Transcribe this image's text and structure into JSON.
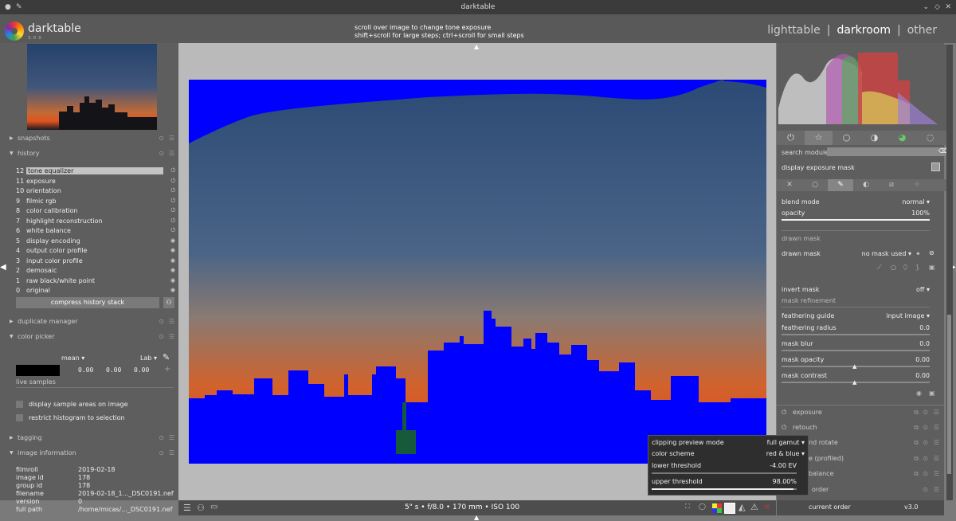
{
  "window": {
    "title": "darktable"
  },
  "header": {
    "app_name": "darktable",
    "app_version": "3.0.0",
    "hint_line1": "scroll over image to change tone exposure",
    "hint_line2": "shift+scroll for large steps; ctrl+scroll for small steps",
    "view_lighttable": "lighttable",
    "view_darkroom": "darkroom",
    "view_other": "other",
    "sep1": "|",
    "sep2": "|"
  },
  "left": {
    "snapshots": "snapshots",
    "history": "history",
    "history_items": [
      {
        "n": "12",
        "label": "tone equalizer"
      },
      {
        "n": "11",
        "label": "exposure"
      },
      {
        "n": "10",
        "label": "orientation"
      },
      {
        "n": "9",
        "label": "filmic rgb"
      },
      {
        "n": "8",
        "label": "color calibration"
      },
      {
        "n": "7",
        "label": "highlight reconstruction"
      },
      {
        "n": "6",
        "label": "white balance"
      },
      {
        "n": "5",
        "label": "display encoding"
      },
      {
        "n": "4",
        "label": "output color profile"
      },
      {
        "n": "3",
        "label": "input color profile"
      },
      {
        "n": "2",
        "label": "demosaic"
      },
      {
        "n": "1",
        "label": "raw black/white point"
      },
      {
        "n": "0",
        "label": "original"
      }
    ],
    "compress": "compress history stack",
    "duplicate_manager": "duplicate manager",
    "color_picker": "color picker",
    "picker_mode": "mean",
    "picker_space": "Lab",
    "picker_values": [
      "0.00",
      "0.00",
      "0.00"
    ],
    "live_samples": "live samples",
    "display_sample": "display sample areas on image",
    "restrict_hist": "restrict histogram to selection",
    "tagging": "tagging",
    "image_information": "image information",
    "info": [
      {
        "k": "filmroll",
        "v": "2019-02-18"
      },
      {
        "k": "image id",
        "v": "178"
      },
      {
        "k": "group id",
        "v": "178"
      },
      {
        "k": "filename",
        "v": "2019-02-18_1..._DSC0191.nef"
      },
      {
        "k": "version",
        "v": "0"
      },
      {
        "k": "full path",
        "v": "/home/micas/..._DSC0191.nef"
      }
    ]
  },
  "bottom": {
    "exposure_info": "5\" s • f/8.0 • 170 mm • ISO 100"
  },
  "right": {
    "search_label": "search module",
    "display_exposure_mask": "display exposure mask",
    "blend_mode": "blend mode",
    "blend_mode_val": "normal",
    "opacity": "opacity",
    "opacity_val": "100%",
    "opacity_level": 1.0,
    "drawn_mask_header": "drawn mask",
    "drawn_mask": "drawn mask",
    "drawn_mask_val": "no mask used",
    "invert_mask": "invert mask",
    "invert_mask_val": "off",
    "mask_refinement": "mask refinement",
    "feathering_guide": "feathering guide",
    "feathering_guide_val": "input image",
    "feathering_radius": "feathering radius",
    "feathering_radius_val": "0.0",
    "mask_blur": "mask blur",
    "mask_blur_val": "0.0",
    "mask_opacity": "mask opacity",
    "mask_opacity_val": "0.00",
    "mask_contrast": "mask contrast",
    "mask_contrast_val": "0.00",
    "modules": [
      "exposure",
      "retouch",
      "nd rotate",
      "e (profiled)",
      "balance",
      "order"
    ],
    "current_order": "current order",
    "current_order_val": "v3.0"
  },
  "popup": {
    "clipping_mode": "clipping preview mode",
    "clipping_mode_val": "full gamut",
    "color_scheme": "color scheme",
    "color_scheme_val": "red & blue",
    "lower": "lower threshold",
    "lower_val": "-4.00 EV",
    "upper": "upper threshold",
    "upper_val": "98.00%",
    "upper_level": 0.98
  },
  "colors": {
    "accent": "#0000ff",
    "sky_top": "#2c4b72",
    "sky_bottom": "#e0551c"
  }
}
